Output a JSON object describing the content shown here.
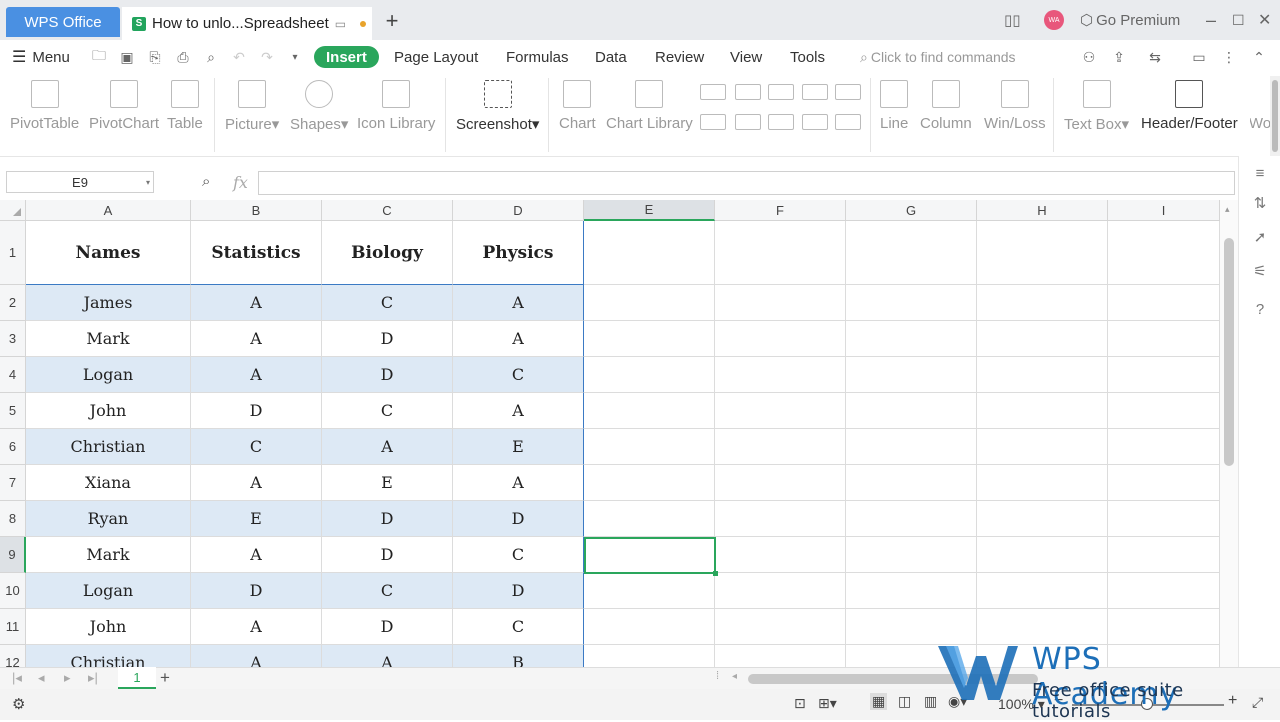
{
  "titlebar": {
    "wps_tab": "WPS Office",
    "doc_tab": "How to unlo...Spreadsheet",
    "go_premium": "Go Premium",
    "avatar": "WA"
  },
  "menubar": {
    "menu": "Menu",
    "tabs": [
      "Insert",
      "Page Layout",
      "Formulas",
      "Data",
      "Review",
      "View",
      "Tools"
    ],
    "active_tab": "Insert",
    "search_placeholder": "Click to find commands"
  },
  "ribbon": {
    "pivot_table": "PivotTable",
    "pivot_chart": "PivotChart",
    "table": "Table",
    "picture": "Picture",
    "shapes": "Shapes",
    "icon_library": "Icon Library",
    "screenshot": "Screenshot",
    "chart": "Chart",
    "chart_library": "Chart Library",
    "line": "Line",
    "column": "Column",
    "win_loss": "Win/Loss",
    "text_box": "Text Box",
    "header_footer": "Header/Footer",
    "wo_cut": "Wo"
  },
  "formula_bar": {
    "name_box": "E9",
    "fx": "fx",
    "value": ""
  },
  "columns": [
    "A",
    "B",
    "C",
    "D",
    "E",
    "F",
    "G",
    "H",
    "I"
  ],
  "selected_column": "E",
  "selected_row": "9",
  "table": {
    "headers": [
      "Names",
      "Statistics",
      "Biology",
      "Physics"
    ],
    "rows": [
      [
        "James",
        "A",
        "C",
        "A"
      ],
      [
        "Mark",
        "A",
        "D",
        "A"
      ],
      [
        "Logan",
        "A",
        "D",
        "C"
      ],
      [
        "John",
        "D",
        "C",
        "A"
      ],
      [
        "Christian",
        "C",
        "A",
        "E"
      ],
      [
        "Xiana",
        "A",
        "E",
        "A"
      ],
      [
        "Ryan",
        "E",
        "D",
        "D"
      ],
      [
        "Mark",
        "A",
        "D",
        "C"
      ],
      [
        "Logan",
        "D",
        "C",
        "D"
      ],
      [
        "John",
        "A",
        "D",
        "C"
      ],
      [
        "Christian",
        "A",
        "A",
        "B"
      ]
    ]
  },
  "row_numbers": [
    "1",
    "2",
    "3",
    "4",
    "5",
    "6",
    "7",
    "8",
    "9",
    "10",
    "11",
    "12"
  ],
  "sheet_tab": "1",
  "status": {
    "zoom": "100%"
  },
  "watermark": {
    "title": "WPS Academy",
    "subtitle": "Free office suite tutorials"
  }
}
